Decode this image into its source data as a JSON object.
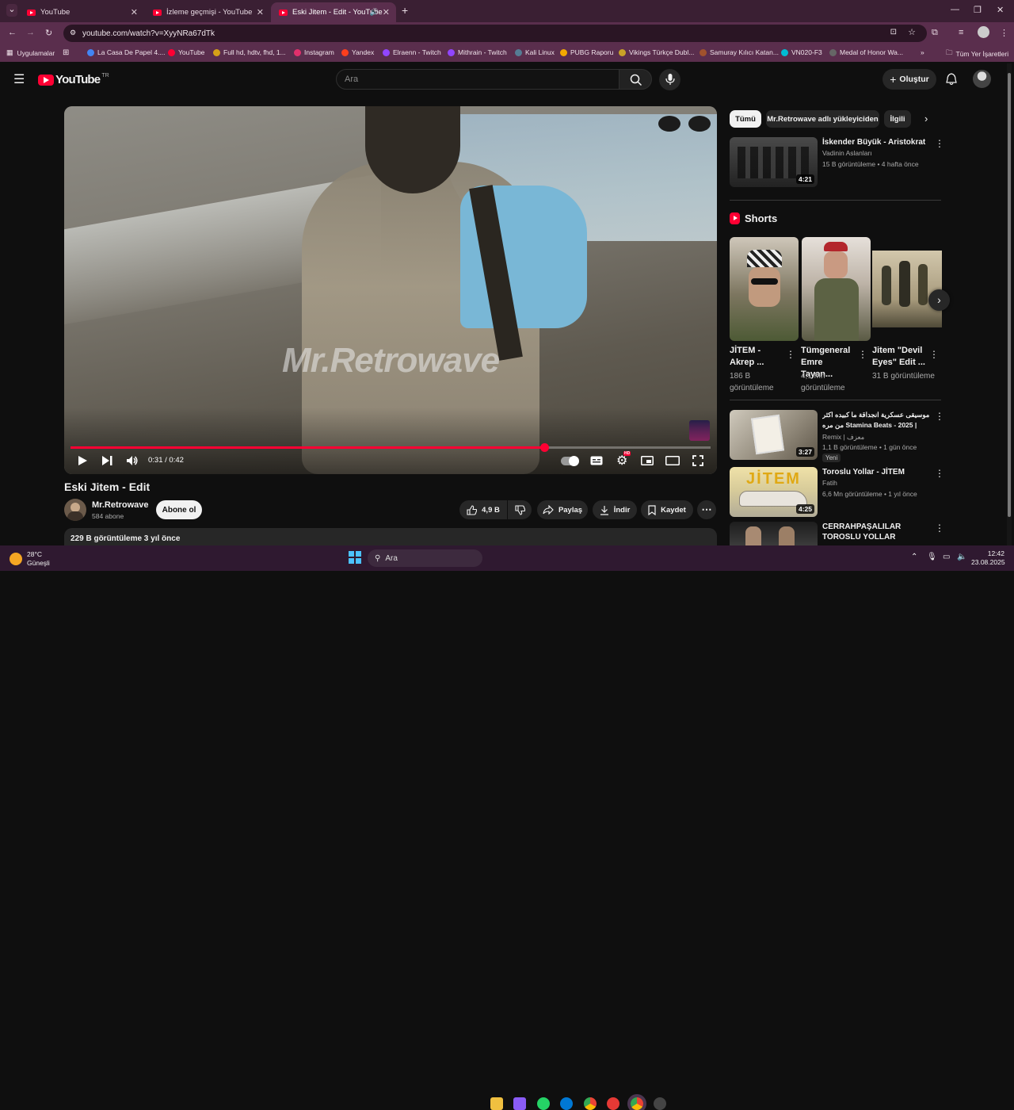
{
  "browser": {
    "tabs": [
      {
        "title": "YouTube"
      },
      {
        "title": "İzleme geçmişi - YouTube"
      },
      {
        "title": "Eski Jitem - Edit - YouTube"
      }
    ],
    "url": "youtube.com/watch?v=XyyNRa67dTk",
    "bookmarks": [
      {
        "label": "Uygulamalar",
        "color": "#8ab4f8"
      },
      {
        "label": "La Casa De Papel 4....",
        "color": "#4285f4"
      },
      {
        "label": "YouTube",
        "color": "#ff0033"
      },
      {
        "label": "Full hd, hdtv, fhd, 1...",
        "color": "#d4a017"
      },
      {
        "label": "Instagram",
        "color": "#e1306c"
      },
      {
        "label": "Yandex",
        "color": "#fc3f1d"
      },
      {
        "label": "Elraenn - Twitch",
        "color": "#9146ff"
      },
      {
        "label": "Mithrain - Twitch",
        "color": "#9146ff"
      },
      {
        "label": "Kali Linux",
        "color": "#557c94"
      },
      {
        "label": "PUBG Raporu",
        "color": "#f2a900"
      },
      {
        "label": "Vikings Türkçe Dubl...",
        "color": "#c9a227"
      },
      {
        "label": "Samuray Kılıcı Katan...",
        "color": "#a0522d"
      },
      {
        "label": "VN020-F3",
        "color": "#00bcd4"
      },
      {
        "label": "Medal of Honor Wa...",
        "color": "#666666"
      }
    ],
    "all_bookmarks": "Tüm Yer İşaretleri"
  },
  "youtube": {
    "logo": "YouTube",
    "logo_region": "TR",
    "search_placeholder": "Ara",
    "create_label": "Oluştur"
  },
  "player": {
    "watermark": "Mr.Retrowave",
    "time": "0:31 / 0:42",
    "progress": 0.74,
    "badge": "HD"
  },
  "video": {
    "title": "Eski Jitem - Edit",
    "channel": "Mr.Retrowave",
    "subscribers": "584 abone",
    "subscribe_label": "Abone ol",
    "likes": "4,9 B",
    "share_label": "Paylaş",
    "download_label": "İndir",
    "save_label": "Kaydet",
    "description_stats": "229 B görüntüleme  3 yıl önce"
  },
  "sidebar": {
    "chips": [
      "Tümü",
      "Mr.Retrowave adlı yükleyiciden",
      "İlgili"
    ],
    "first": {
      "title": "İskender Büyük - Aristokrat",
      "channel": "Vadinin Aslanları",
      "meta": "15 B görüntüleme • 4 hafta önce",
      "duration": "4:21"
    },
    "shorts_heading": "Shorts",
    "shorts": [
      {
        "title": "JİTEM - Akrep ...",
        "views": "186 B görüntüleme"
      },
      {
        "title": "Tümgeneral Emre Tayan...",
        "views": "4,1 Mn görüntüleme"
      },
      {
        "title": "Jitem \"Devil Eyes\" Edit ...",
        "views": "31 B görüntüleme"
      }
    ],
    "videos": [
      {
        "title": "موسيقى عسكرية انجداقة ما كبيده اكثر من مره Stamina Beats - 2025 | روعة ...",
        "channel": "Remix | معزف",
        "meta": "1,1 B görüntüleme • 1 gün önce",
        "badge": "Yeni",
        "duration": "3:27"
      },
      {
        "title": "Toroslu Yollar - JİTEM",
        "channel": "Fatih",
        "meta": "6,6 Mn görüntüleme • 1 yıl önce",
        "duration": "4:25"
      },
      {
        "title": "CERRAHPAŞALILAR TOROSLU YOLLAR",
        "channel": "",
        "meta": ""
      }
    ]
  },
  "taskbar": {
    "weather_temp": "28°C",
    "weather_desc": "Güneşli",
    "search_label": "Ara",
    "time": "12:42",
    "date": "23.08.2025"
  }
}
